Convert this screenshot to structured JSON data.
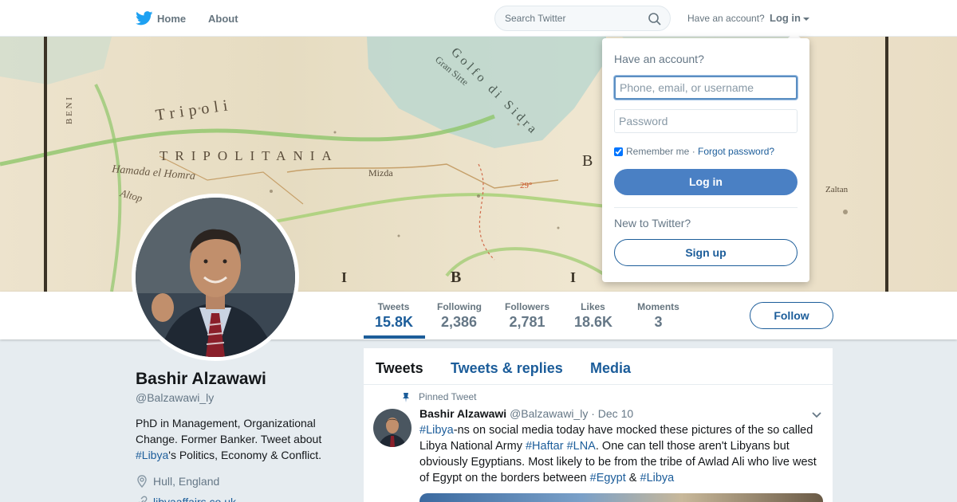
{
  "nav": {
    "home_label": "Home",
    "about_label": "About",
    "search_placeholder": "Search Twitter",
    "have_account_text": "Have an account?",
    "login_label": "Log in"
  },
  "banner": {
    "map_labels": [
      "Tripoli",
      "TRIPOLITANIA",
      "Golfo di Sidra",
      "Gran Sirte",
      "Hamada el Homra",
      "Altop",
      "B",
      "I",
      "B",
      "I",
      "Mizda"
    ]
  },
  "profile": {
    "name": "Bashir Alzawawi",
    "handle": "@Balzawawi_ly",
    "bio_before": "PhD in Management, Organizational Change. Former Banker. Tweet about ",
    "bio_tag": "#Libya",
    "bio_after": "'s Politics, Economy & Conflict.",
    "location": "Hull, England",
    "url_partial": "libyaaffairs.co.uk"
  },
  "stats": [
    {
      "label": "Tweets",
      "value": "15.8K"
    },
    {
      "label": "Following",
      "value": "2,386"
    },
    {
      "label": "Followers",
      "value": "2,781"
    },
    {
      "label": "Likes",
      "value": "18.6K"
    },
    {
      "label": "Moments",
      "value": "3"
    }
  ],
  "follow_label": "Follow",
  "timeline": {
    "tabs": [
      "Tweets",
      "Tweets & replies",
      "Media"
    ],
    "pinned_label": "Pinned Tweet",
    "tweet": {
      "author": "Bashir Alzawawi",
      "handle": "@Balzawawi_ly",
      "date": "Dec 10",
      "p1_tag": "#Libya",
      "p1": "-ns on social media today have mocked these pictures of the so called Libya National Army ",
      "p2_tag": "#Haftar",
      "p3_tag": "#LNA",
      "p3": ".  One can tell those aren't Libyans but obviously Egyptians. Most likely to be from the tribe of Awlad Ali who live west of Egypt on the borders between ",
      "p4_tag": "#Egypt",
      "p4": " & ",
      "p5_tag": "#Libya"
    }
  },
  "login_dropdown": {
    "title": "Have an account?",
    "username_placeholder": "Phone, email, or username",
    "password_placeholder": "Password",
    "remember_label": "Remember me",
    "separator": " · ",
    "forgot_label": "Forgot password?",
    "login_button": "Log in",
    "new_text": "New to Twitter?",
    "signup_button": "Sign up"
  },
  "colors": {
    "accent": "#1c5d9a",
    "login_button": "#4a80c4",
    "page_bg": "#e6ecf0"
  }
}
